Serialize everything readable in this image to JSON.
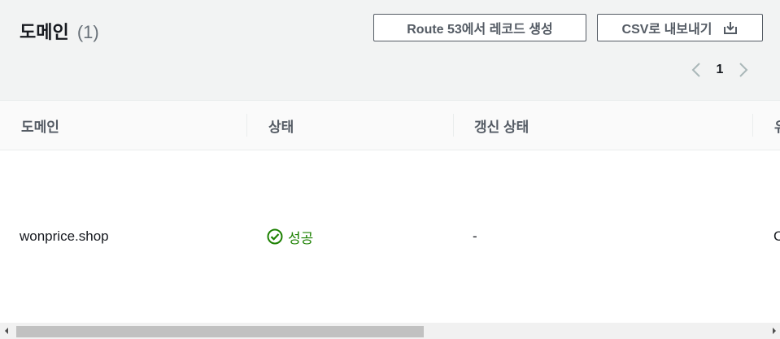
{
  "header": {
    "title": "도메인",
    "count": "(1)",
    "route53_button": "Route 53에서 레코드 생성",
    "csv_button": "CSV로 내보내기",
    "csv_icon": "download-icon"
  },
  "pagination": {
    "current_page": "1",
    "prev_icon": "chevron-left-icon",
    "next_icon": "chevron-right-icon"
  },
  "table": {
    "columns": [
      "도메인",
      "상태",
      "갱신 상태",
      "유"
    ],
    "rows": [
      {
        "domain": "wonprice.shop",
        "status": "성공",
        "status_icon": "check-circle-icon",
        "renewal_status": "-",
        "extra": "C"
      }
    ]
  },
  "colors": {
    "success": "#1d8102",
    "header_bg": "#f2f3f3",
    "button_border": "#545b64"
  }
}
